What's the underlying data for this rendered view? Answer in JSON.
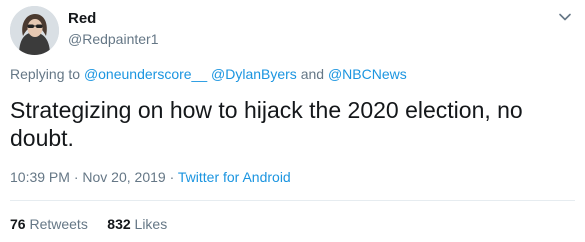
{
  "author": {
    "display_name": "Red",
    "username": "@Redpainter1"
  },
  "icons": {
    "avatar": "profile-photo",
    "menu": "chevron-down-icon"
  },
  "reply_context": {
    "prefix": "Replying to ",
    "mention_1": "@oneunderscore__",
    "mention_2": "@DylanByers",
    "conjunction": " and ",
    "mention_3": "@NBCNews"
  },
  "tweet": {
    "text": "Strategizing on how to hijack the 2020 election, no doubt."
  },
  "meta": {
    "time": "10:39 PM",
    "separator_1": " · ",
    "date": "Nov 20, 2019",
    "separator_2": " · ",
    "source": "Twitter for Android"
  },
  "stats": {
    "retweets_count": "76",
    "retweets_label": " Retweets",
    "likes_count": "832",
    "likes_label": " Likes"
  },
  "colors": {
    "link": "#1b95e0",
    "secondary_text": "#657786",
    "primary_text": "#14171a",
    "divider": "#e6ecf0"
  }
}
